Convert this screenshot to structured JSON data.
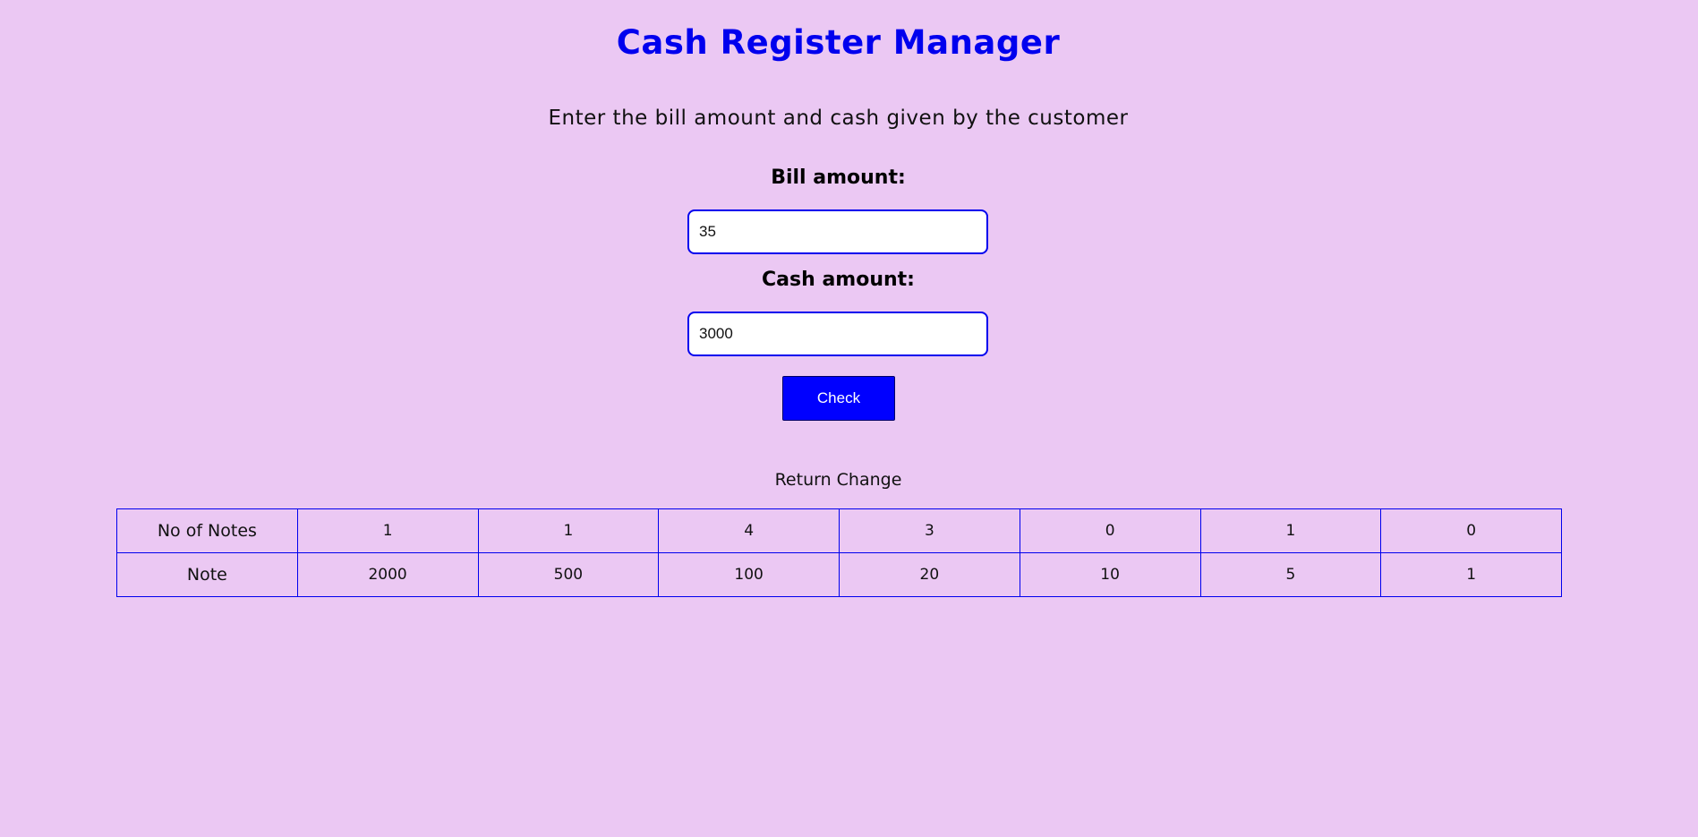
{
  "header": {
    "title": "Cash Register Manager",
    "subtitle": "Enter the bill amount and cash given by the customer"
  },
  "form": {
    "bill_label": "Bill amount:",
    "bill_value": "35",
    "cash_label": "Cash amount:",
    "cash_value": "3000",
    "check_label": "Check"
  },
  "result": {
    "caption": "Return Change",
    "rows": [
      {
        "label": "No of Notes",
        "cells": [
          "1",
          "1",
          "4",
          "3",
          "0",
          "1",
          "0"
        ]
      },
      {
        "label": "Note",
        "cells": [
          "2000",
          "500",
          "100",
          "20",
          "10",
          "5",
          "1"
        ]
      }
    ]
  },
  "colors": {
    "background": "#ebc8f3",
    "accent": "#0000ee",
    "button": "#0000ff"
  }
}
